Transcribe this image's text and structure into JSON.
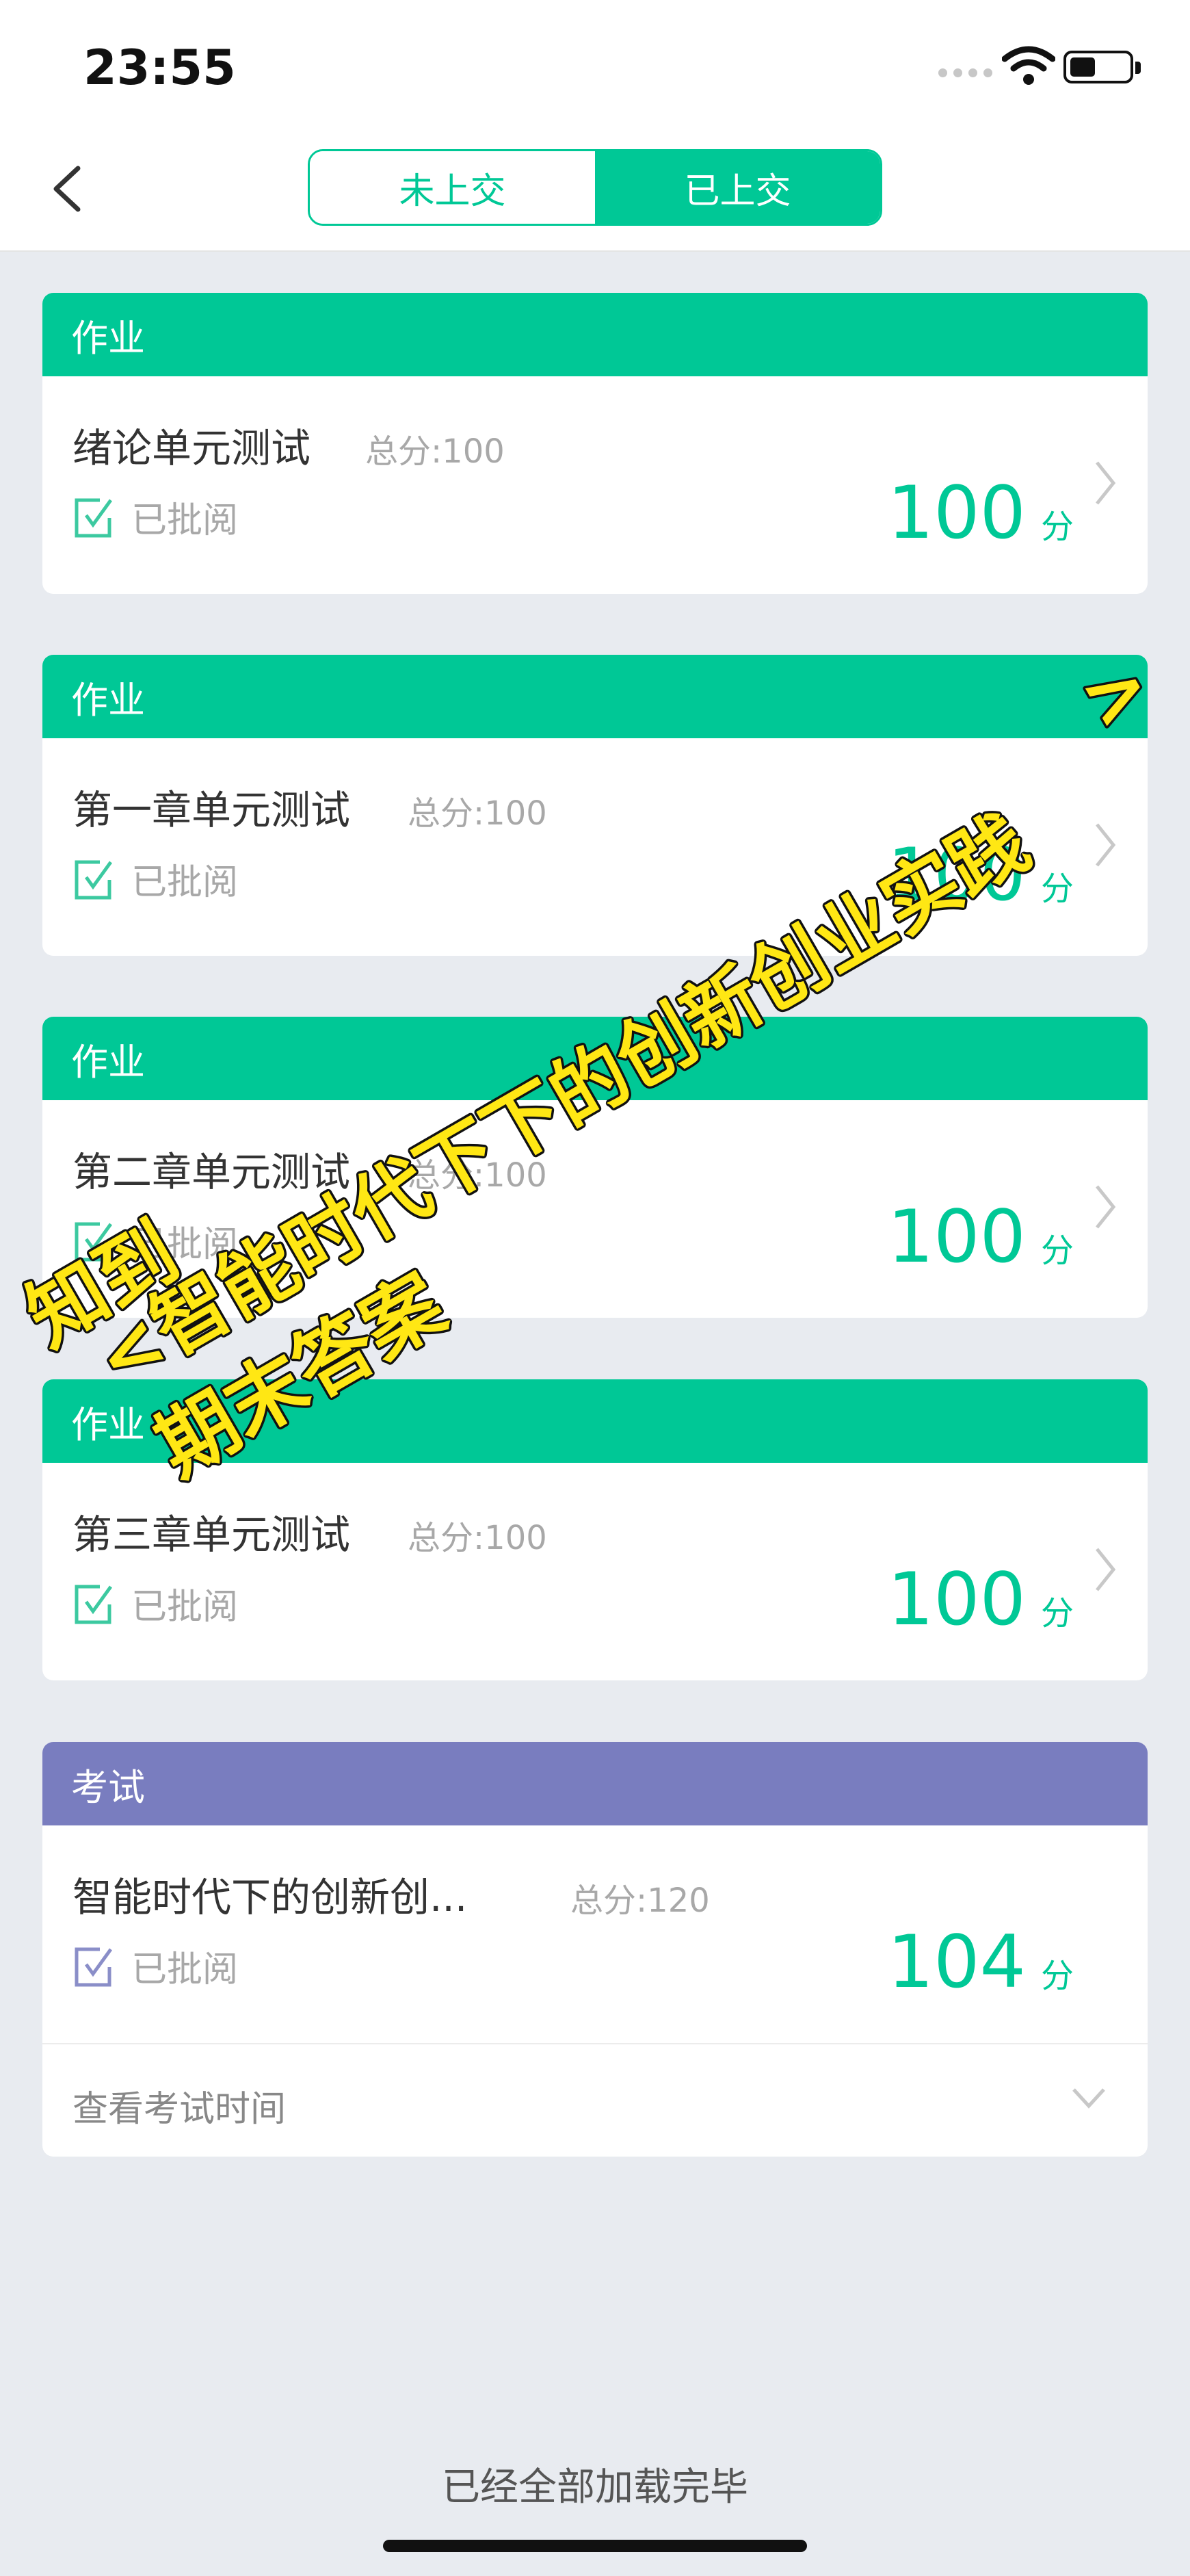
{
  "status_bar": {
    "time": "23:55"
  },
  "tabs": {
    "not_submitted": "未上交",
    "submitted": "已上交"
  },
  "cards": [
    {
      "category": "作业",
      "title": "绪论单元测试",
      "total": "总分:100",
      "status": "已批阅",
      "score": "100",
      "unit": "分"
    },
    {
      "category": "作业",
      "title": "第一章单元测试",
      "total": "总分:100",
      "status": "已批阅",
      "score": "100",
      "unit": "分"
    },
    {
      "category": "作业",
      "title": "第二章单元测试",
      "total": "总分:100",
      "status": "已批阅",
      "score": "100",
      "unit": "分"
    },
    {
      "category": "作业",
      "title": "第三章单元测试",
      "total": "总分:100",
      "status": "已批阅",
      "score": "100",
      "unit": "分"
    }
  ],
  "exam": {
    "category": "考试",
    "title": "智能时代下的创新创...",
    "total": "总分:120",
    "status": "已批阅",
    "score": "104",
    "unit": "分",
    "view_time": "查看考试时间"
  },
  "footer": "已经全部加载完毕",
  "overlay": {
    "line1": "知到",
    "line2": "<智能时代下下的创新创业实践",
    "line3": ">",
    "line4": "期末答案"
  },
  "colors": {
    "accent": "#00c896",
    "exam_header": "#797dbf",
    "overlay_text": "#ffe714"
  }
}
